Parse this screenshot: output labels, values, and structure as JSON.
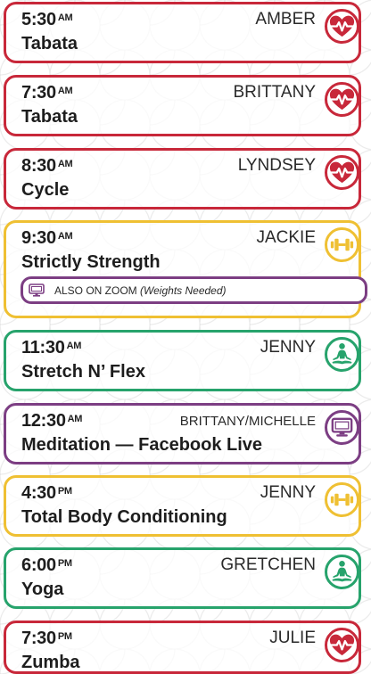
{
  "schedule": [
    {
      "time": "5:30",
      "ampm": "AM",
      "instructor": "AMBER",
      "class_name": "Tabata",
      "color": "#c8283a",
      "icon": "heart-rate-icon"
    },
    {
      "time": "7:30",
      "ampm": "AM",
      "instructor": "BRITTANY",
      "class_name": "Tabata",
      "color": "#c8283a",
      "icon": "heart-rate-icon"
    },
    {
      "time": "8:30",
      "ampm": "AM",
      "instructor": "LYNDSEY",
      "class_name": "Cycle",
      "color": "#c8283a",
      "icon": "heart-rate-icon"
    },
    {
      "time": "9:30",
      "ampm": "AM",
      "instructor": "JACKIE",
      "class_name": "Strictly Strength",
      "color": "#efc033",
      "icon": "dumbbell-icon"
    },
    {
      "time": "11:30",
      "ampm": "AM",
      "instructor": "JENNY",
      "class_name": "Stretch N’ Flex",
      "color": "#27a36c",
      "icon": "meditation-icon"
    },
    {
      "time": "12:30",
      "ampm": "AM",
      "instructor": "BRITTANY/MICHELLE",
      "class_name": "Meditation — Facebook Live",
      "color": "#7c3e83",
      "icon": "monitor-icon"
    },
    {
      "time": "4:30",
      "ampm": "PM",
      "instructor": "JENNY",
      "class_name": "Total Body Conditioning",
      "color": "#efc033",
      "icon": "dumbbell-icon"
    },
    {
      "time": "6:00",
      "ampm": "PM",
      "instructor": "GRETCHEN",
      "class_name": "Yoga",
      "color": "#27a36c",
      "icon": "meditation-icon"
    },
    {
      "time": "7:30",
      "ampm": "PM",
      "instructor": "JULIE",
      "class_name": "Zumba",
      "color": "#c8283a",
      "icon": "heart-rate-icon"
    }
  ],
  "zoom_note": {
    "label": "ALSO ON ZOOM",
    "detail": "(Weights Needed)",
    "icon": "monitor-icon",
    "color": "#7c3e83"
  }
}
